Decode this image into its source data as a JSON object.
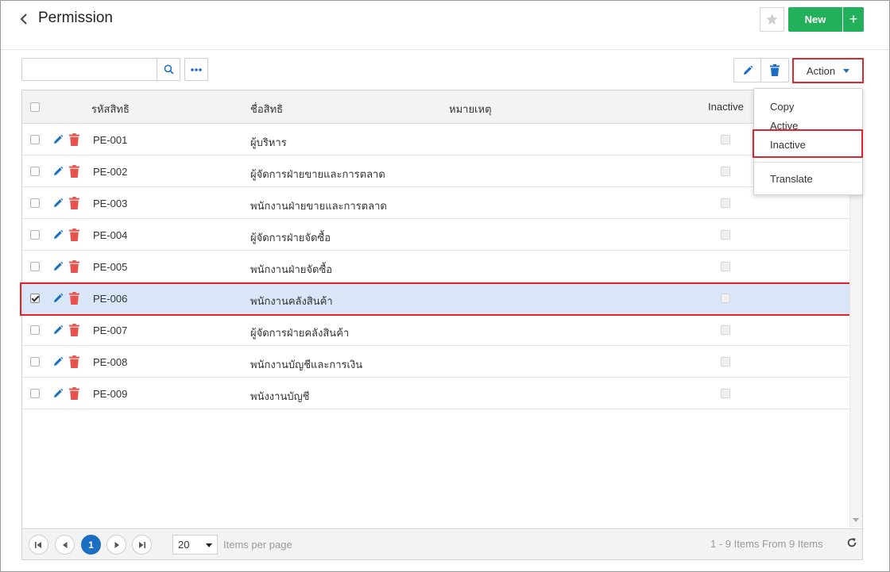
{
  "header": {
    "title": "Permission",
    "new_label": "New",
    "add_symbol": "+"
  },
  "toolbar": {
    "search_placeholder": "",
    "action_label": "Action"
  },
  "grid": {
    "columns": {
      "code": "รหัสสิทธิ",
      "name": "ชื่อสิทธิ",
      "remark": "หมายเหตุ",
      "inactive": "Inactive"
    },
    "rows": [
      {
        "code": "PE-001",
        "name": "ผู้บริหาร",
        "checked": false
      },
      {
        "code": "PE-002",
        "name": "ผู้จัดการฝ่ายขายและการตลาด",
        "checked": false
      },
      {
        "code": "PE-003",
        "name": "พนักงานฝ่ายขายและการตลาด",
        "checked": false
      },
      {
        "code": "PE-004",
        "name": "ผู้จัดการฝ่ายจัดซื้อ",
        "checked": false
      },
      {
        "code": "PE-005",
        "name": "พนักงานฝ่ายจัดซื้อ",
        "checked": false
      },
      {
        "code": "PE-006",
        "name": "พนักงานคลังสินค้า",
        "checked": true
      },
      {
        "code": "PE-007",
        "name": "ผู้จัดการฝ่ายคลังสินค้า",
        "checked": false
      },
      {
        "code": "PE-008",
        "name": "พนักงานบัญชีและการเงิน",
        "checked": false
      },
      {
        "code": "PE-009",
        "name": "พนังงานบัญชี",
        "checked": false
      }
    ]
  },
  "action_menu": {
    "items": [
      "Copy",
      "Active",
      "Inactive",
      "Translate"
    ]
  },
  "pager": {
    "current_page": "1",
    "page_size": "20",
    "items_per_page_label": "Items per page",
    "info": "1 - 9 Items From 9 Items"
  },
  "colors": {
    "brand_green": "#22b05b",
    "accent_blue": "#1a6fc2",
    "delete_red": "#e8534e",
    "highlight_red": "#e02530",
    "selected_row": "#d9e6f7"
  },
  "icons": [
    "back-icon",
    "star-icon",
    "search-icon",
    "more-icon",
    "edit-icon",
    "trash-icon",
    "caret-down-icon",
    "first-page-icon",
    "prev-page-icon",
    "next-page-icon",
    "last-page-icon",
    "refresh-icon"
  ]
}
